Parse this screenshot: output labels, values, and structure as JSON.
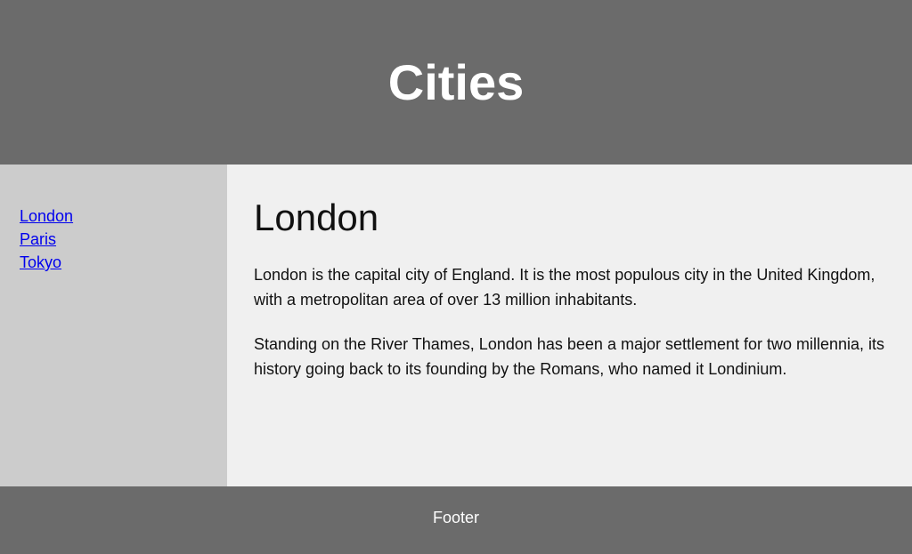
{
  "header": {
    "title": "Cities"
  },
  "nav": {
    "items": [
      {
        "label": "London"
      },
      {
        "label": "Paris"
      },
      {
        "label": "Tokyo"
      }
    ]
  },
  "article": {
    "title": "London",
    "paragraphs": [
      "London is the capital city of England. It is the most populous city in the United Kingdom, with a metropolitan area of over 13 million inhabitants.",
      "Standing on the River Thames, London has been a major settlement for two millennia, its history going back to its founding by the Romans, who named it Londinium."
    ]
  },
  "footer": {
    "text": "Footer"
  }
}
